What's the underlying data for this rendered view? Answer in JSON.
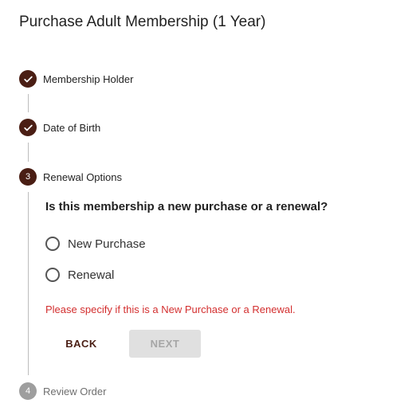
{
  "page": {
    "title": "Purchase Adult Membership (1 Year)"
  },
  "stepper": {
    "steps": [
      {
        "label": "Membership Holder",
        "status": "completed",
        "icon": "check-icon"
      },
      {
        "label": "Date of Birth",
        "status": "completed",
        "icon": "check-icon"
      },
      {
        "number": "3",
        "label": "Renewal Options",
        "status": "active"
      },
      {
        "number": "4",
        "label": "Review Order",
        "status": "pending"
      }
    ]
  },
  "renewal_form": {
    "question": "Is this membership a new purchase or a renewal?",
    "options": [
      {
        "label": "New Purchase",
        "selected": false
      },
      {
        "label": "Renewal",
        "selected": false
      }
    ],
    "error": "Please specify if this is a New Purchase or a Renewal.",
    "back_label": "BACK",
    "next_label": "NEXT",
    "next_disabled": true
  },
  "colors": {
    "brand": "#4a1e14",
    "error": "#d32f2f",
    "pending": "#9e9e9e",
    "disabled_bg": "#e0e0e0",
    "disabled_text": "#a6a6a6"
  }
}
